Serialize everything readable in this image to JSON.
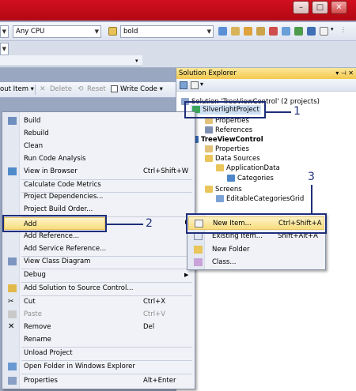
{
  "window": {
    "min": "–",
    "max": "□",
    "close": "✕"
  },
  "toolbar": {
    "config_combo": "",
    "platform_combo": "Any CPU",
    "find_combo": "bold"
  },
  "tabstrip": {
    "item1": "out Item ▾",
    "delete": "Delete",
    "reset": "Reset",
    "write_code": "Write Code ▾"
  },
  "solution_explorer": {
    "title": "Solution Explorer",
    "pin": "▾ ⊣ ✕",
    "tree": [
      {
        "label": "Solution 'TreeViewControl' (2 projects)"
      },
      {
        "label": "SilverlightProject"
      },
      {
        "label": "Properties"
      },
      {
        "label": "References"
      },
      {
        "label": "TreeViewControl"
      },
      {
        "label": "Properties"
      },
      {
        "label": "Data Sources"
      },
      {
        "label": "ApplicationData"
      },
      {
        "label": "Categories"
      },
      {
        "label": "Screens"
      },
      {
        "label": "EditableCategoriesGrid"
      }
    ]
  },
  "context_menu": {
    "items": [
      {
        "label": "Build",
        "shortcut": ""
      },
      {
        "label": "Rebuild",
        "shortcut": ""
      },
      {
        "label": "Clean",
        "shortcut": ""
      },
      {
        "label": "Run Code Analysis",
        "shortcut": ""
      },
      {
        "label": "View in Browser",
        "shortcut": "Ctrl+Shift+W"
      },
      {
        "label": "Calculate Code Metrics",
        "shortcut": ""
      },
      {
        "label": "Project Dependencies...",
        "shortcut": ""
      },
      {
        "label": "Project Build Order...",
        "shortcut": ""
      },
      {
        "label": "Add",
        "shortcut": ""
      },
      {
        "label": "Add Reference...",
        "shortcut": ""
      },
      {
        "label": "Add Service Reference...",
        "shortcut": ""
      },
      {
        "label": "View Class Diagram",
        "shortcut": ""
      },
      {
        "label": "Debug",
        "shortcut": ""
      },
      {
        "label": "Add Solution to Source Control...",
        "shortcut": ""
      },
      {
        "label": "Cut",
        "shortcut": "Ctrl+X"
      },
      {
        "label": "Paste",
        "shortcut": "Ctrl+V"
      },
      {
        "label": "Remove",
        "shortcut": "Del"
      },
      {
        "label": "Rename",
        "shortcut": ""
      },
      {
        "label": "Unload Project",
        "shortcut": ""
      },
      {
        "label": "Open Folder in Windows Explorer",
        "shortcut": ""
      },
      {
        "label": "Properties",
        "shortcut": "Alt+Enter"
      }
    ]
  },
  "add_submenu": {
    "items": [
      {
        "label": "New Item...",
        "shortcut": "Ctrl+Shift+A"
      },
      {
        "label": "Existing Item...",
        "shortcut": "Shift+Alt+A"
      },
      {
        "label": "New Folder",
        "shortcut": ""
      },
      {
        "label": "Class...",
        "shortcut": ""
      }
    ]
  },
  "callouts": {
    "one": "1",
    "two": "2",
    "three": "3"
  },
  "colors": {
    "accent": "#1f2e7a",
    "highlight": "#f8dd7e",
    "titlebar": "#c10d1a"
  }
}
